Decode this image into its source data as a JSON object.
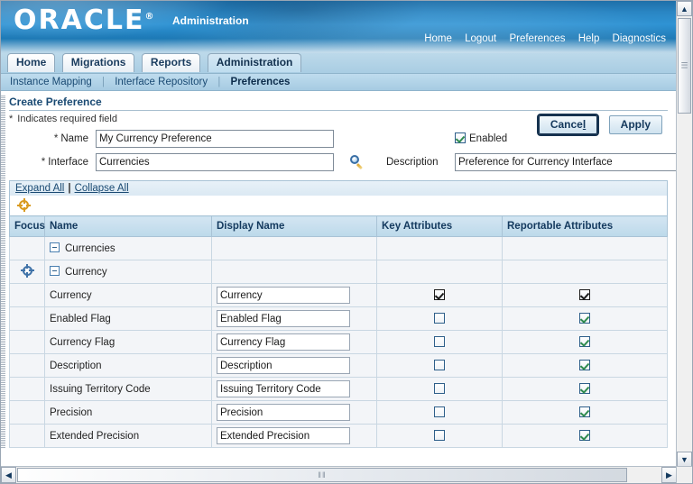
{
  "header": {
    "logo_text": "ORACLE",
    "logo_reg": "®",
    "app_title": "Administration",
    "global_links": [
      {
        "label": "Home"
      },
      {
        "label": "Logout"
      },
      {
        "label": "Preferences"
      },
      {
        "label": "Help"
      },
      {
        "label": "Diagnostics"
      }
    ]
  },
  "tabs": [
    {
      "label": "Home",
      "selected": false
    },
    {
      "label": "Migrations",
      "selected": false
    },
    {
      "label": "Reports",
      "selected": false
    },
    {
      "label": "Administration",
      "selected": true
    }
  ],
  "subtabs": [
    {
      "label": "Instance Mapping",
      "active": false
    },
    {
      "label": "Interface Repository",
      "active": false
    },
    {
      "label": "Preferences",
      "active": true
    }
  ],
  "page": {
    "title": "Create Preference",
    "required_note": "Indicates required field",
    "required_star": "*"
  },
  "actions": {
    "cancel_label_pre": "Cance",
    "cancel_label_key": "l",
    "apply_label": "Apply"
  },
  "form": {
    "name_label": "Name",
    "name_value": "My Currency Preference",
    "interface_label": "Interface",
    "interface_value": "Currencies",
    "lov_icon": "search-icon",
    "enabled_label": "Enabled",
    "enabled_checked": true,
    "description_label": "Description",
    "description_value": "Preference for Currency Interface"
  },
  "tree_toolbar": {
    "expand_all": "Expand All",
    "collapse_all": "Collapse All",
    "separator": "|",
    "focus_icon": "focus-target-icon"
  },
  "table": {
    "columns": {
      "focus": "Focus",
      "name": "Name",
      "display_name": "Display Name",
      "key_attributes": "Key Attributes",
      "reportable_attributes": "Reportable Attributes"
    },
    "rows": [
      {
        "level": 1,
        "name": "Currencies",
        "expandable": true,
        "expanded": true,
        "focus": false,
        "display_name": null,
        "key": null,
        "reportable": null
      },
      {
        "level": 2,
        "name": "Currency",
        "expandable": true,
        "expanded": true,
        "focus": true,
        "display_name": null,
        "key": null,
        "reportable": null
      },
      {
        "level": 3,
        "name": "Currency",
        "expandable": false,
        "focus": false,
        "display_name": "Currency",
        "key": "checked-dark",
        "reportable": "checked-dark"
      },
      {
        "level": 3,
        "name": "Enabled Flag",
        "expandable": false,
        "focus": false,
        "display_name": "Enabled Flag",
        "key": "unchecked",
        "reportable": "checked-green"
      },
      {
        "level": 3,
        "name": "Currency Flag",
        "expandable": false,
        "focus": false,
        "display_name": "Currency Flag",
        "key": "unchecked",
        "reportable": "checked-green"
      },
      {
        "level": 3,
        "name": "Description",
        "expandable": false,
        "focus": false,
        "display_name": "Description",
        "key": "unchecked",
        "reportable": "checked-green"
      },
      {
        "level": 3,
        "name": "Issuing Territory Code",
        "expandable": false,
        "focus": false,
        "display_name": "Issuing Territory Code",
        "key": "unchecked",
        "reportable": "checked-green"
      },
      {
        "level": 3,
        "name": "Precision",
        "expandable": false,
        "focus": false,
        "display_name": "Precision",
        "key": "unchecked",
        "reportable": "checked-green"
      },
      {
        "level": 3,
        "name": "Extended Precision",
        "expandable": false,
        "focus": false,
        "display_name": "Extended Precision",
        "key": "unchecked",
        "reportable": "checked-green"
      }
    ]
  },
  "scrollbars": {
    "up_arrow": "▲",
    "down_arrow": "▼",
    "left_arrow": "◀",
    "right_arrow": "▶",
    "grip": "‖‖"
  },
  "colors": {
    "brand_blue": "#2a86c4",
    "link_blue": "#1a4a73",
    "check_green": "#2f8b4f",
    "focus_gold": "#d99a1f",
    "focus_blue": "#3f72a8"
  }
}
